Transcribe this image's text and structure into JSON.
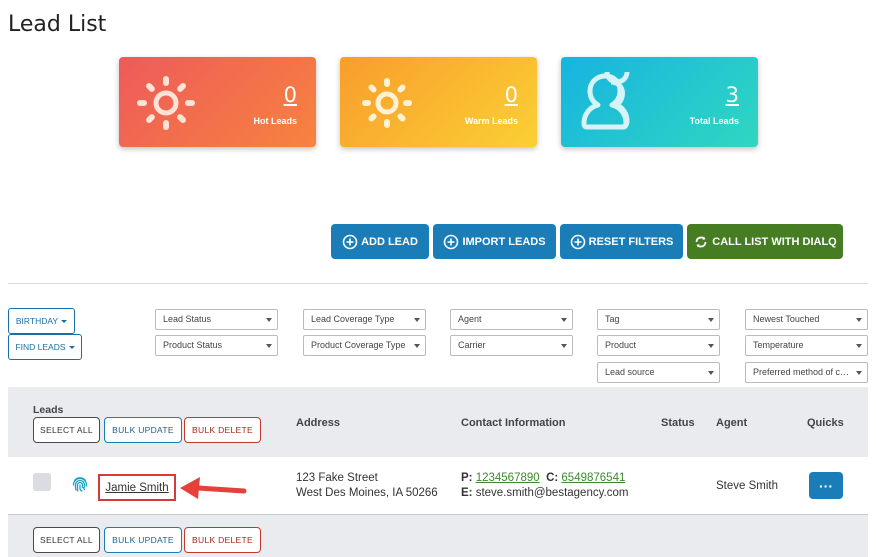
{
  "page": {
    "title": "Lead List"
  },
  "stats": [
    {
      "count": "0",
      "label": "Hot Leads",
      "icon": "sun-icon"
    },
    {
      "count": "0",
      "label": "Warm Leads",
      "icon": "sun-icon"
    },
    {
      "count": "3",
      "label": "Total Leads",
      "icon": "users-icon"
    }
  ],
  "actions": {
    "add_lead": "ADD LEAD",
    "import_leads": "IMPORT LEADS",
    "reset_filters": "RESET FILTERS",
    "call_list": "CALL LIST WITH DIALQ"
  },
  "filters": {
    "birthday": "BIRTHDAY",
    "find_leads": "FIND LEADS",
    "lead_status": "Lead Status",
    "product_status": "Product Status",
    "lead_coverage_type": "Lead Coverage Type",
    "product_coverage_type": "Product Coverage Type",
    "agent": "Agent",
    "carrier": "Carrier",
    "tag": "Tag",
    "product": "Product",
    "lead_source": "Lead source",
    "sort": "Newest Touched",
    "temperature": "Temperature",
    "preferred_contact": "Preferred method of contact"
  },
  "table": {
    "headers": {
      "leads": "Leads",
      "address": "Address",
      "contact": "Contact Information",
      "status": "Status",
      "agent": "Agent",
      "quicks": "Quicks"
    },
    "bulk": {
      "select_all": "SELECT ALL",
      "bulk_update": "BULK UPDATE",
      "bulk_delete": "BULK DELETE"
    },
    "rows": [
      {
        "name": "Jamie Smith",
        "address_line1": "123 Fake Street",
        "address_line2": "West Des Moines, IA 50266",
        "phone_label": "P:",
        "phone": "1234567890",
        "cell_label": "C:",
        "cell": "6549876541",
        "email_label": "E:",
        "email": "steve.smith@bestagency.com",
        "status": "",
        "agent": "Steve Smith",
        "quick_label": "···"
      }
    ]
  },
  "colors": {
    "primary": "#1a7db8",
    "green": "#477d22",
    "hot": "#ee5a5a",
    "warm": "#f89d2c",
    "total": "#17b4e0",
    "highlight": "#d83a3a"
  }
}
